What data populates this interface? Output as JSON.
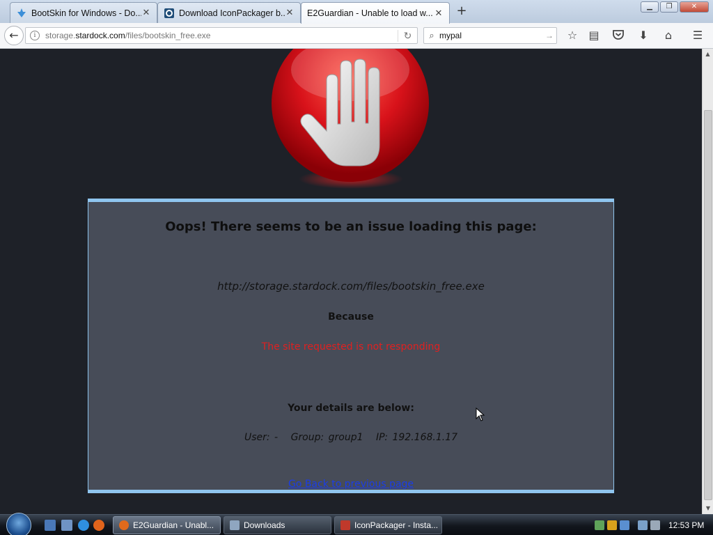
{
  "browser": {
    "tabs": [
      {
        "label": "BootSkin for Windows - Do...",
        "favicon": "stardock-download-icon",
        "active": false
      },
      {
        "label": "Download IconPackager b...",
        "favicon": "iconpackager-icon",
        "active": false
      },
      {
        "label": "E2Guardian - Unable to load w...",
        "favicon": "none",
        "active": true
      }
    ],
    "new_tab_symbol": "+",
    "url_prefix": "storage.",
    "url_domain": "stardock.com",
    "url_path": "/files/bootskin_free.exe",
    "search_value": "mypal"
  },
  "page": {
    "title": "Oops! There seems to be an issue loading this page:",
    "blocked_url": "http://storage.stardock.com/files/bootskin_free.exe",
    "because_label": "Because",
    "reason": "The site requested is not responding",
    "details_label": "Your details are below:",
    "user": "User: -",
    "group": "Group: group1",
    "ip": "IP: 192.168.1.17",
    "go_back": "Go Back to previous page"
  },
  "taskbar": {
    "buttons": [
      {
        "label": "E2Guardian - Unabl...",
        "icon": "firefox-icon",
        "active": true
      },
      {
        "label": "Downloads",
        "icon": "downloads-icon",
        "active": false
      },
      {
        "label": "IconPackager - Insta...",
        "icon": "iconpackager-installer-icon",
        "active": false
      }
    ],
    "clock": "12:53 PM"
  },
  "colors": {
    "panel_background": "#474c58",
    "panel_border": "#8fc5ef",
    "reason_red": "#e02020",
    "link_blue": "#1a3de8",
    "page_background": "#1e2128"
  }
}
